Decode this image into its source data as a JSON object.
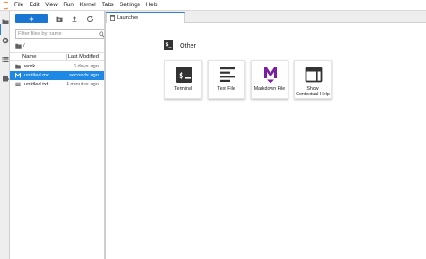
{
  "menubar": {
    "items": [
      "File",
      "Edit",
      "View",
      "Run",
      "Kernel",
      "Tabs",
      "Settings",
      "Help"
    ]
  },
  "sidebar": {
    "icons": [
      "folder-icon",
      "running-icon",
      "commands-icon",
      "extensions-icon"
    ]
  },
  "file_browser": {
    "new_button_label": "+",
    "filter_placeholder": "Filter files by name",
    "breadcrumb_root": "/",
    "columns": {
      "name": "Name",
      "modified": "Last Modified"
    },
    "files": [
      {
        "name": "work",
        "modified": "3 days ago",
        "type": "folder",
        "selected": false
      },
      {
        "name": "untitled.md",
        "modified": "seconds ago",
        "type": "markdown",
        "selected": true
      },
      {
        "name": "untitled.txt",
        "modified": "4 minutes ago",
        "type": "text",
        "selected": false
      }
    ]
  },
  "tabs": [
    {
      "label": "Launcher",
      "active": true
    }
  ],
  "launcher": {
    "section_title": "Other",
    "section_icon_text": "$_",
    "cards": [
      {
        "label": "Terminal",
        "icon": "terminal-icon"
      },
      {
        "label": "Text File",
        "icon": "text-file-icon"
      },
      {
        "label": "Markdown File",
        "icon": "markdown-icon"
      },
      {
        "label": "Show Contextual Help",
        "icon": "contextual-help-icon"
      }
    ]
  },
  "colors": {
    "accent": "#1976d2",
    "selected_row": "#1e88e5",
    "markdown": "#7b1fa2",
    "logo": "#f37726"
  }
}
